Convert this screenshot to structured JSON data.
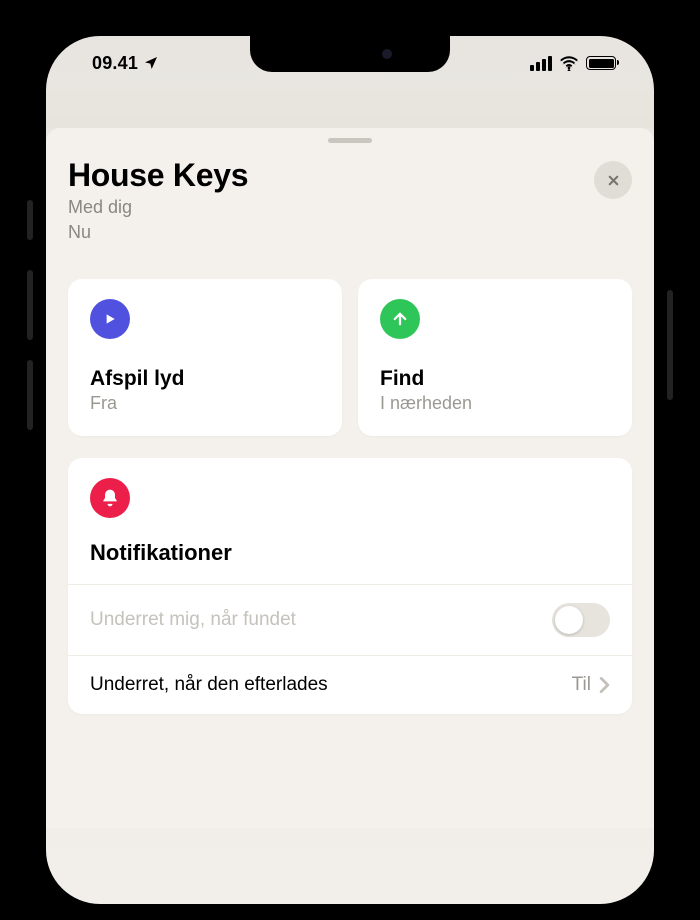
{
  "status": {
    "time": "09.41"
  },
  "sheet": {
    "title": "House Keys",
    "subtitle_line1": "Med dig",
    "subtitle_line2": "Nu"
  },
  "actions": {
    "play": {
      "title": "Afspil lyd",
      "status": "Fra"
    },
    "find": {
      "title": "Find",
      "status": "I nærheden"
    }
  },
  "notifications": {
    "section_title": "Notifikationer",
    "notify_found": {
      "label": "Underret mig, når fundet",
      "enabled": false
    },
    "notify_left": {
      "label": "Underret, når den efterlades",
      "value": "Til"
    }
  }
}
